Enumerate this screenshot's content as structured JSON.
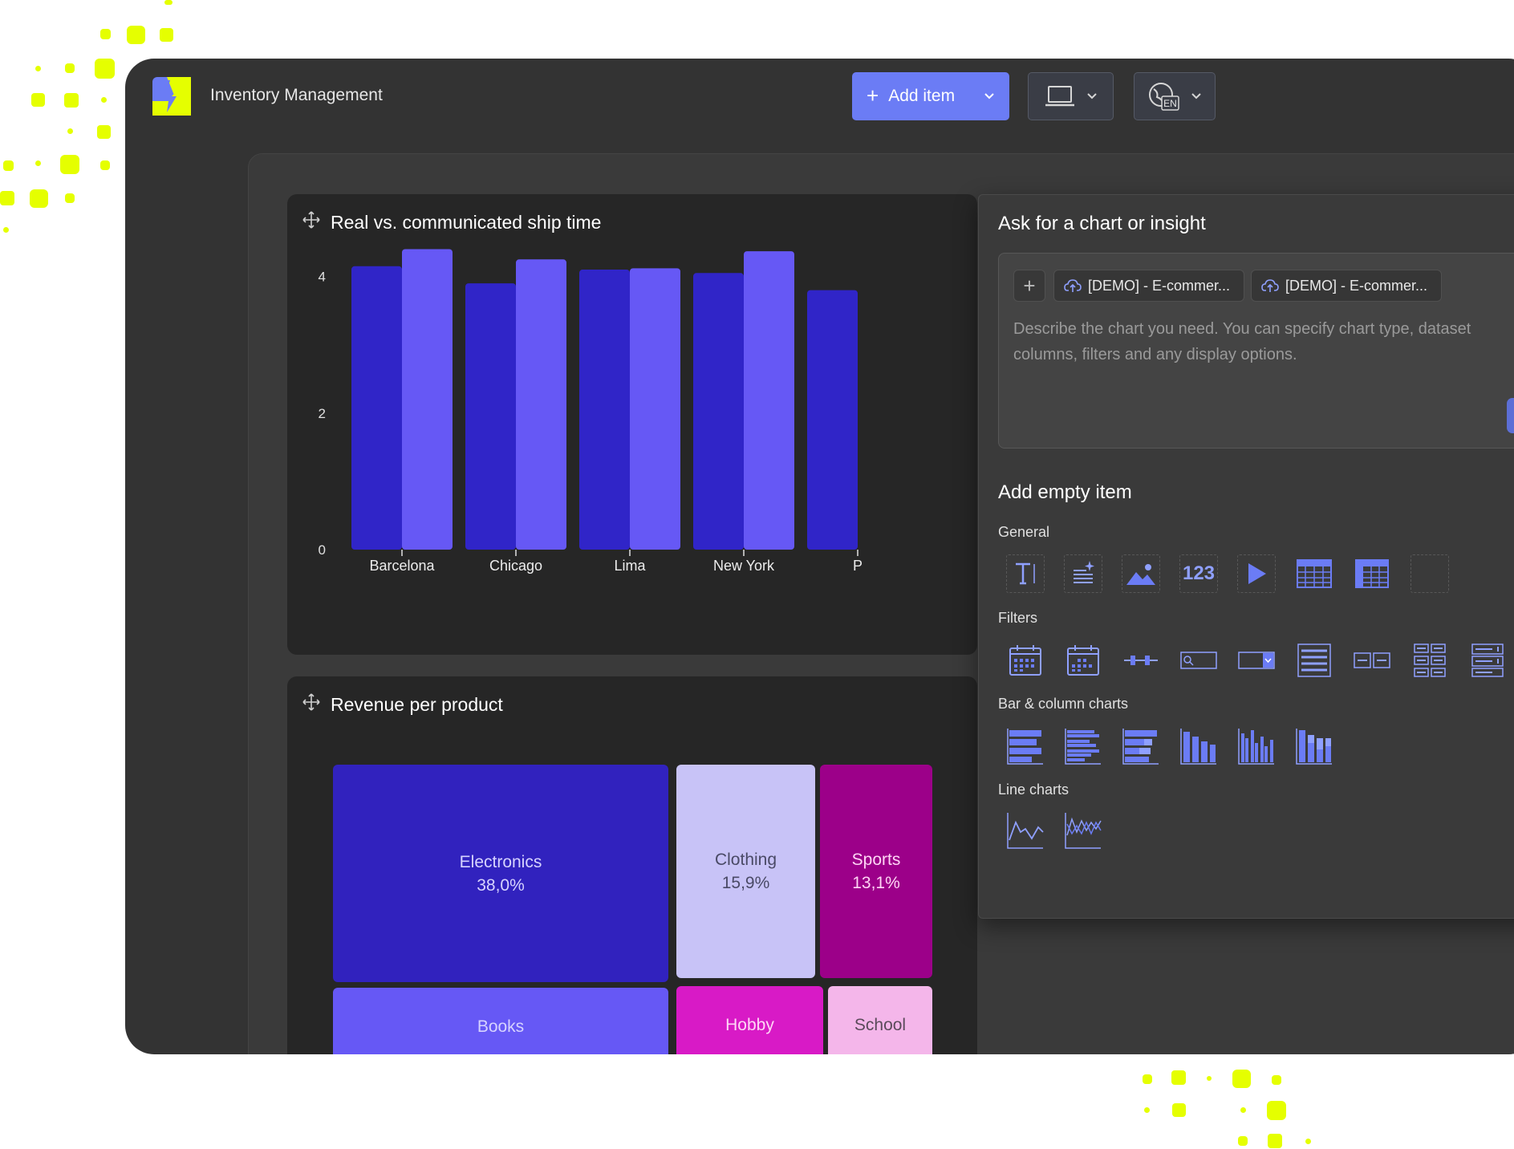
{
  "app": {
    "title": "Inventory Management"
  },
  "toolbar": {
    "add_item_label": "Add item",
    "language_code": "EN"
  },
  "colors": {
    "accent": "#6b7cf5",
    "bar_dark": "#3025c8",
    "bar_light": "#6658f5",
    "highlight": "#e5ff00"
  },
  "cards": [
    {
      "title": "Real vs. communicated ship time",
      "chart_data": {
        "type": "bar",
        "categories": [
          "Barcelona",
          "Chicago",
          "Lima",
          "New York",
          "P"
        ],
        "series": [
          {
            "values": [
              4.15,
              3.9,
              4.1,
              4.05,
              3.8
            ]
          },
          {
            "values": [
              4.4,
              4.25,
              4.12,
              4.37,
              null
            ]
          }
        ],
        "yticks": [
          "0",
          "2",
          "4"
        ],
        "ylim": [
          0,
          4.5
        ]
      }
    },
    {
      "title": "Revenue per product",
      "chart_data": {
        "type": "treemap",
        "items": [
          {
            "name": "Electronics",
            "value": "38,0%",
            "color": "#3122be"
          },
          {
            "name": "Clothing",
            "value": "15,9%",
            "color": "#c8c3f7"
          },
          {
            "name": "Sports",
            "value": "13,1%",
            "color": "#9c0089"
          },
          {
            "name": "Books",
            "value": "",
            "color": "#6658f5"
          },
          {
            "name": "Hobby",
            "value": "",
            "color": "#d81ac6"
          },
          {
            "name": "School",
            "value": "",
            "color": "#f4b6ea"
          }
        ]
      }
    }
  ],
  "popup": {
    "ask_title": "Ask for a chart or insight",
    "chips": [
      "[DEMO] - E-commer...",
      "[DEMO] - E-commer..."
    ],
    "prompt_placeholder": "Describe the chart you need. You can specify chart type, dataset columns, filters and any display options.",
    "add_empty_title": "Add empty item",
    "sections": {
      "general": {
        "label": "General",
        "icons": [
          "text-icon",
          "ai-text-icon",
          "image-icon",
          "number-icon",
          "video-icon",
          "table-icon",
          "pivot-table-icon",
          "empty-icon"
        ]
      },
      "filters": {
        "label": "Filters",
        "icons": [
          "date-filter-icon",
          "date-range-filter-icon",
          "slider-filter-icon",
          "search-filter-icon",
          "dropdown-filter-icon",
          "list-filter-icon",
          "button-group-filter-icon",
          "grid-filter-icon",
          "multi-list-filter-icon"
        ]
      },
      "bar_column": {
        "label": "Bar & column charts",
        "icons": [
          "bar-chart-icon",
          "grouped-bar-chart-icon",
          "stacked-bar-chart-icon",
          "column-chart-icon",
          "grouped-column-chart-icon",
          "stacked-column-chart-icon"
        ]
      },
      "line": {
        "label": "Line charts",
        "icons": [
          "line-chart-icon",
          "multi-line-chart-icon"
        ]
      }
    },
    "number_icon_text": "123"
  }
}
